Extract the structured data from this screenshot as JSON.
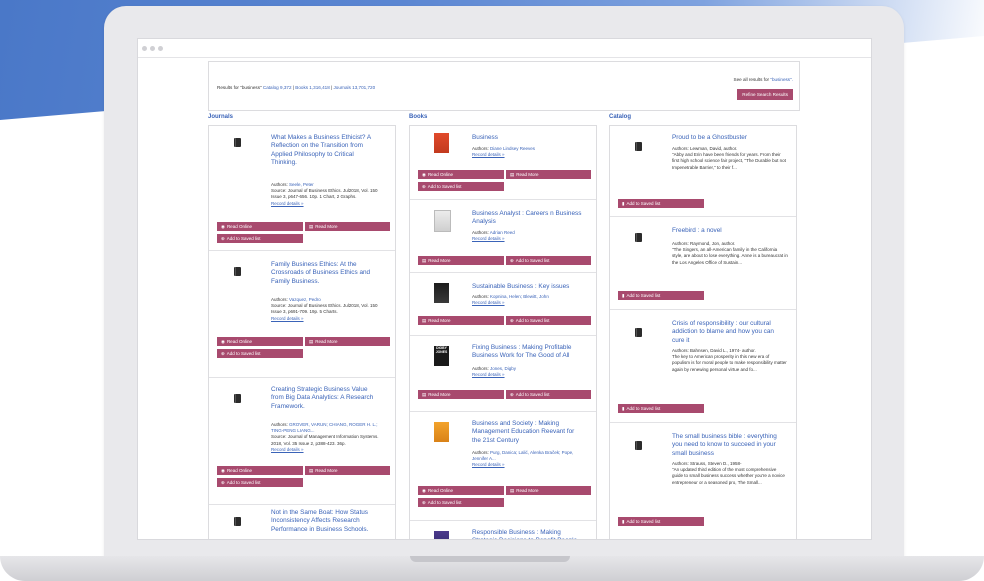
{
  "results": {
    "prefix": "Results for \"business\"",
    "catalog": "Catalog 9,372",
    "books": "Books 1,316,418",
    "journals": "Journals 13,701,720",
    "see_all_prefix": "See all results for",
    "see_all_link": "\"business\".",
    "refine": "Refine Search Results"
  },
  "columns": {
    "journals": "Journals",
    "books": "Books",
    "catalog": "Catalog"
  },
  "buttons": {
    "read_online": "Read Online",
    "read_more": "Read More",
    "add_saved": "Add to Saved list"
  },
  "journals": [
    {
      "title": "What Makes a Business Ethicist? A Reflection on the Transition from Applied Philosophy to Critical Thinking.",
      "authors_label": "Authors:",
      "authors": "Seele, Peter",
      "source": "Source: Journal of Business Ethics. Jul2018, Vol. 150 Issue 3, p647-656. 10p. 1 Chart, 2 Graphs.",
      "details": "Record details »"
    },
    {
      "title": "Family Business Ethics: At the Crossroads of Business Ethics and Family Business.",
      "authors_label": "Authors:",
      "authors": "Vazquez, Pedro",
      "source": "Source: Journal of Business Ethics. Jul2018, Vol. 150 Issue 3, p691-709. 19p. 5 Charts.",
      "details": "Record details »"
    },
    {
      "title": "Creating Strategic Business Value from Big Data Analytics: A Research Framework.",
      "authors_label": "Authors:",
      "authors": "GROVER, VARUN; CHIANG, ROGER H. L.; TING-PENG LIANG...",
      "source": "Source: Journal of Management Information Systems. 2018, Vol. 35 Issue 2, p388-423. 36p.",
      "details": "Record details »"
    },
    {
      "title": "Not in the Same Boat: How Status Inconsistency Affects Research Performance in Business Schools."
    }
  ],
  "books": [
    {
      "title": "Business",
      "authors_label": "Authors:",
      "authors": "Diane Lindsey Reeves",
      "details": "Record details »"
    },
    {
      "title": "Business Analyst : Careers n Business Analysis",
      "authors_label": "Authors:",
      "authors": "Adrian Reed",
      "details": "Record details »"
    },
    {
      "title": "Sustainable Business : Key issues",
      "authors_label": "Authors:",
      "authors": "Kopnina, Helen; Blewitt, John",
      "details": "Record details »"
    },
    {
      "title": "Fixing Business : Making Profitable Business Work for The Good of All",
      "authors_label": "Authors:",
      "authors": "Jones, Digby",
      "details": "Record details »",
      "cover_text": "DIGBY JONES"
    },
    {
      "title": "Business and Society : Making Management Education Reevant for the 21st Century",
      "authors_label": "Authors:",
      "authors": "Purg, Danica; Lalić, Alenka Braček; Pope, Jennifer A...",
      "details": "Record details »"
    },
    {
      "title": "Responsible Business : Making Strategic Decisions to Benefit People"
    }
  ],
  "catalog": [
    {
      "title": "Proud to be a Ghostbuster",
      "authors": "Authors: Lewman, David, author.",
      "desc": "\"Abby and Erin have been friends for years. From their first high school science fair project, \"The Durable but not Impenetrable Barrier,\" to their f..."
    },
    {
      "title": "Freebird : a novel",
      "authors": "Authors: Raymond, Jon, author.",
      "desc": "\"The Singers, an all-American family in the California style, are about to lose everything. Anne is a bureaucrat in the Los Angeles Office of Sustain..."
    },
    {
      "title": "Crisis of responsibility : our cultural addiction to blame and how you can cure it",
      "authors": "Authors: Bahnsen, David L., 1974- author.",
      "desc": "The key to American prosperity in this new era of populism is for moral people to make responsibility matter again by renewing personal virtue and fo..."
    },
    {
      "title": "The small business bible : everything you need to know to succeed in your small business",
      "authors": "Authors: Strauss, Steven D., 1958-",
      "desc": "\"An updated third edition of the most comprehensive guide to small business success whether you're a novice entrepreneur or a seasoned pro, The Small..."
    }
  ]
}
